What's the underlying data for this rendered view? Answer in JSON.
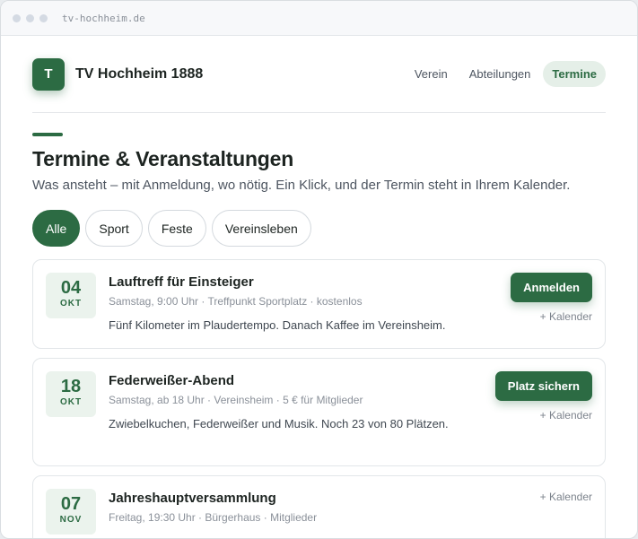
{
  "browser": {
    "url": "tv-hochheim.de"
  },
  "header": {
    "logo_letter": "T",
    "site_name": "TV Hochheim 1888",
    "nav": [
      {
        "label": "Verein",
        "active": false
      },
      {
        "label": "Abteilungen",
        "active": false
      },
      {
        "label": "Termine",
        "active": true
      }
    ]
  },
  "hero": {
    "title": "Termine & Veranstaltungen",
    "subtitle": "Was ansteht – mit Anmeldung, wo nötig. Ein Klick, und der Termin steht in Ihrem Kalender."
  },
  "filters": [
    {
      "label": "Alle",
      "active": true
    },
    {
      "label": "Sport",
      "active": false
    },
    {
      "label": "Feste",
      "active": false
    },
    {
      "label": "Vereinsleben",
      "active": false
    }
  ],
  "events": [
    {
      "day": "04",
      "month": "OKT",
      "title": "Lauftreff für Einsteiger",
      "meta": "Samstag, 9:00 Uhr · Treffpunkt Sportplatz · kostenlos",
      "description": "Fünf Kilometer im Plaudertempo. Danach Kaffee im Vereinsheim.",
      "button": "Anmelden",
      "calendar": "+ Kalender"
    },
    {
      "day": "18",
      "month": "OKT",
      "title": "Federweißer-Abend",
      "meta": "Samstag, ab 18 Uhr · Vereinsheim · 5 € für Mitglieder",
      "description": "Zwiebelkuchen, Federweißer und Musik. Noch 23 von 80 Plätzen.",
      "button": "Platz sichern",
      "calendar": "+ Kalender"
    },
    {
      "day": "07",
      "month": "NOV",
      "title": "Jahreshauptversammlung",
      "meta": "Freitag, 19:30 Uhr · Bürgerhaus · Mitglieder",
      "description": "",
      "button": "",
      "calendar": "+ Kalender"
    }
  ]
}
